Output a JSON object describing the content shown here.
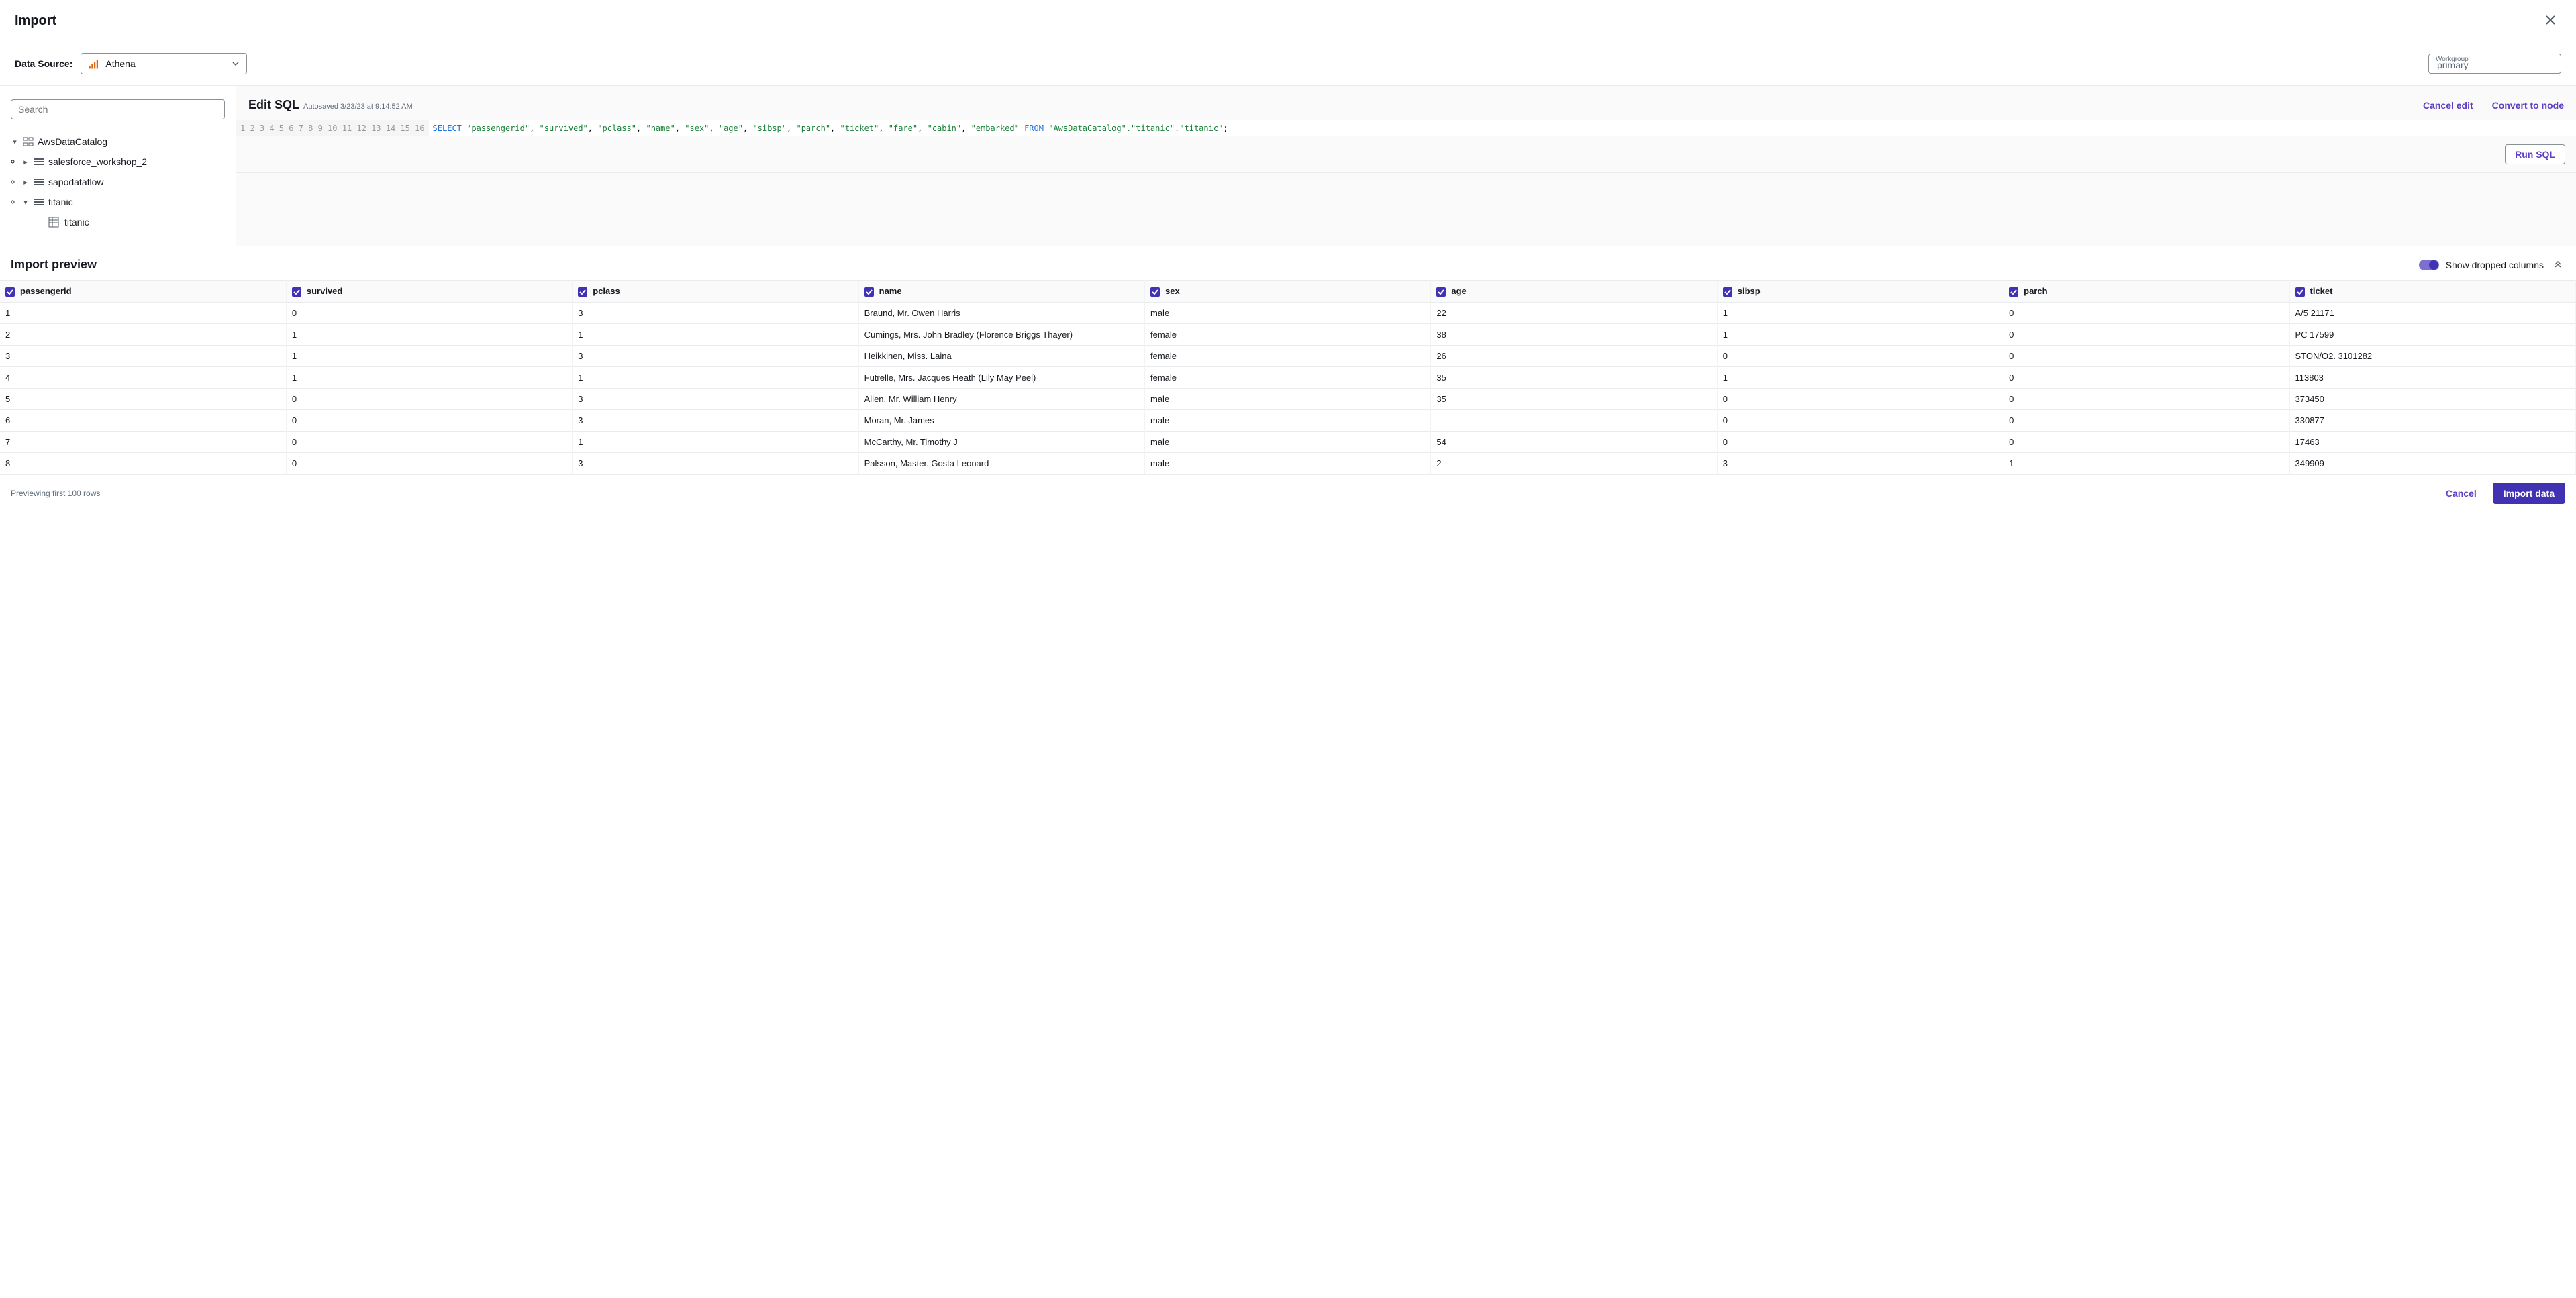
{
  "header": {
    "title": "Import"
  },
  "datasource": {
    "label": "Data Source:",
    "selected": "Athena",
    "workgroup_label": "Workgroup",
    "workgroup_value": "primary"
  },
  "sidebar": {
    "search_placeholder": "Search",
    "tree": {
      "root": "AwsDataCatalog",
      "children": [
        {
          "label": "salesforce_workshop_2",
          "expanded": false
        },
        {
          "label": "sapodataflow",
          "expanded": false
        },
        {
          "label": "titanic",
          "expanded": true,
          "leaves": [
            "titanic"
          ]
        }
      ]
    }
  },
  "editor": {
    "title": "Edit SQL",
    "autosaved": "Autosaved 3/23/23 at 9:14:52 AM",
    "cancel_edit": "Cancel edit",
    "convert": "Convert to node",
    "run": "Run SQL",
    "sql": {
      "select_kw": "SELECT",
      "columns": [
        "\"passengerid\"",
        "\"survived\"",
        "\"pclass\"",
        "\"name\"",
        "\"sex\"",
        "\"age\"",
        "\"sibsp\"",
        "\"parch\"",
        "\"ticket\"",
        "\"fare\"",
        "\"cabin\"",
        "\"embarked\""
      ],
      "from_kw": "FROM",
      "table": "\"AwsDataCatalog\".\"titanic\".\"titanic\"",
      "line_count": 16
    }
  },
  "preview": {
    "title": "Import preview",
    "toggle_label": "Show dropped columns",
    "columns": [
      "passengerid",
      "survived",
      "pclass",
      "name",
      "sex",
      "age",
      "sibsp",
      "parch",
      "ticket"
    ],
    "rows": [
      [
        "1",
        "0",
        "3",
        "Braund, Mr. Owen Harris",
        "male",
        "22",
        "1",
        "0",
        "A/5 21171"
      ],
      [
        "2",
        "1",
        "1",
        "Cumings, Mrs. John Bradley (Florence Briggs Thayer)",
        "female",
        "38",
        "1",
        "0",
        "PC 17599"
      ],
      [
        "3",
        "1",
        "3",
        "Heikkinen, Miss. Laina",
        "female",
        "26",
        "0",
        "0",
        "STON/O2. 3101282"
      ],
      [
        "4",
        "1",
        "1",
        "Futrelle, Mrs. Jacques Heath (Lily May Peel)",
        "female",
        "35",
        "1",
        "0",
        "113803"
      ],
      [
        "5",
        "0",
        "3",
        "Allen, Mr. William Henry",
        "male",
        "35",
        "0",
        "0",
        "373450"
      ],
      [
        "6",
        "0",
        "3",
        "Moran, Mr. James",
        "male",
        "",
        "0",
        "0",
        "330877"
      ],
      [
        "7",
        "0",
        "1",
        "McCarthy, Mr. Timothy J",
        "male",
        "54",
        "0",
        "0",
        "17463"
      ],
      [
        "8",
        "0",
        "3",
        "Palsson, Master. Gosta Leonard",
        "male",
        "2",
        "3",
        "1",
        "349909"
      ]
    ]
  },
  "footer": {
    "status": "Previewing first 100 rows",
    "cancel": "Cancel",
    "import": "Import data"
  }
}
